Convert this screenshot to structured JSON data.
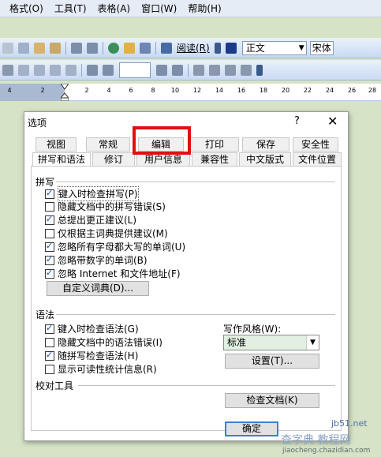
{
  "menubar": {
    "items": [
      "格式(O)",
      "工具(T)",
      "表格(A)",
      "窗口(W)",
      "帮助(H)"
    ]
  },
  "toolbar1": {
    "reading_label": "阅读(R)",
    "style_value": "正文",
    "font_value": "宋体"
  },
  "ruler": {
    "ticks": [
      "4",
      "2",
      "2",
      "4",
      "6",
      "8",
      "10",
      "12",
      "14",
      "16",
      "18",
      "20",
      "22",
      "24",
      "26",
      "28"
    ]
  },
  "dialog": {
    "title": "选项",
    "help": "?",
    "close": "✕",
    "tabs_row1": [
      "视图",
      "常规",
      "编辑",
      "打印",
      "保存",
      "安全性"
    ],
    "tabs_row2": [
      "拼写和语法",
      "修订",
      "用户信息",
      "兼容性",
      "中文版式",
      "文件位置"
    ],
    "spelling": {
      "heading": "拼写",
      "options": [
        {
          "label": "键入时检查拼写(P)",
          "checked": true
        },
        {
          "label": "隐藏文档中的拼写错误(S)",
          "checked": false
        },
        {
          "label": "总提出更正建议(L)",
          "checked": true
        },
        {
          "label": "仅根据主词典提供建议(M)",
          "checked": false
        },
        {
          "label": "忽略所有字母都大写的单词(U)",
          "checked": true
        },
        {
          "label": "忽略带数字的单词(B)",
          "checked": true
        },
        {
          "label": "忽略 Internet 和文件地址(F)",
          "checked": true
        }
      ],
      "custom_dict_button": "自定义词典(D)..."
    },
    "grammar": {
      "heading": "语法",
      "options": [
        {
          "label": "键入时检查语法(G)",
          "checked": true
        },
        {
          "label": "隐藏文档中的语法错误(I)",
          "checked": false
        },
        {
          "label": "随拼写检查语法(H)",
          "checked": true
        },
        {
          "label": "显示可读性统计信息(R)",
          "checked": false
        }
      ],
      "writing_style_label": "写作风格(W):",
      "writing_style_value": "标准",
      "settings_button": "设置(T)..."
    },
    "proofing": {
      "heading": "校对工具",
      "check_document_button": "检查文档(K)"
    },
    "ok_button": "确定"
  },
  "watermark": {
    "site": "jb51.net",
    "brand": "查字典 教程网",
    "url": "jiaocheng.chazidian.com"
  },
  "colors": {
    "highlight": "#e01010",
    "background": "#d6e3c6",
    "check": "#0c4aa6"
  }
}
